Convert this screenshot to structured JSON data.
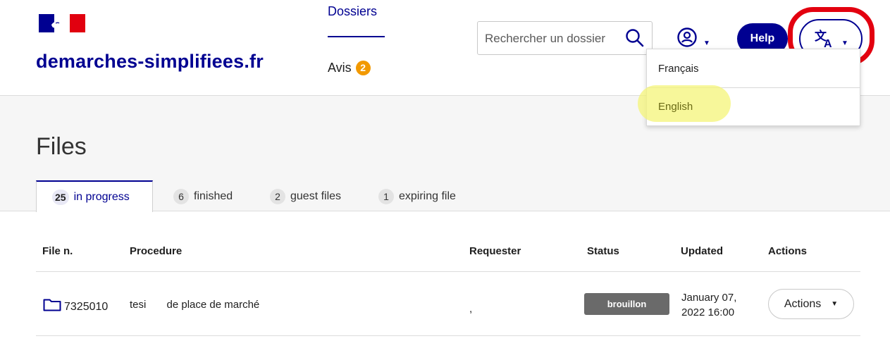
{
  "header": {
    "site_name": "demarches-simplifiees.fr",
    "nav": [
      {
        "label": "Dossiers"
      },
      {
        "label": "Avis",
        "badge": "2"
      }
    ],
    "search": {
      "placeholder": "Rechercher un dossier"
    },
    "help_label": "Help"
  },
  "language_menu": {
    "items": [
      {
        "label": "Français"
      },
      {
        "label": "English"
      }
    ]
  },
  "page": {
    "title": "Files",
    "tabs": [
      {
        "count": "25",
        "label": "in progress"
      },
      {
        "count": "6",
        "label": "finished"
      },
      {
        "count": "2",
        "label": "guest files"
      },
      {
        "count": "1",
        "label": "expiring file"
      }
    ]
  },
  "table": {
    "columns": [
      "File n.",
      "Procedure",
      "Requester",
      "Status",
      "Updated",
      "Actions"
    ],
    "rows": [
      {
        "file_number": "7325010",
        "procedure": "tesi       de place de marché",
        "requester": ",",
        "status": "brouillon",
        "updated_line1": "January 07,",
        "updated_line2": "2022 16:00",
        "actions_label": "Actions"
      }
    ]
  },
  "colors": {
    "primary": "#000091",
    "badge_orange": "#f29900",
    "annotation_red": "#e3000f",
    "annotation_yellow": "#f4f478",
    "status_grey": "#6a6a6a"
  },
  "icons": [
    "marianne-flag-icon",
    "search-icon",
    "user-account-icon",
    "translate-icon",
    "folder-icon",
    "caret-down-icon"
  ]
}
